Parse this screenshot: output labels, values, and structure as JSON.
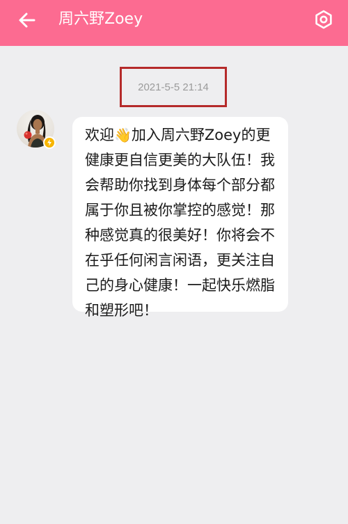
{
  "header": {
    "title": "周六野Zoey",
    "back_icon": "arrow-left-icon",
    "settings_icon": "hexagon-settings-icon",
    "background_color": "#fc6b91"
  },
  "chat": {
    "timestamp": "2021-5-5 21:14",
    "message": {
      "part1": "欢迎",
      "emoji": "👋",
      "part2": "加入周六野Zoey的更健康更自信更美的大队伍！我会帮助你找到身体每个部分都属于你且被你掌控的感觉！那种感觉真的很美好！你将会不在乎任何闲言闲语，更关注自己的身心健康！一起快乐燃脂和塑形吧！"
    },
    "avatar_badge_icon": "lightning-badge-icon"
  }
}
